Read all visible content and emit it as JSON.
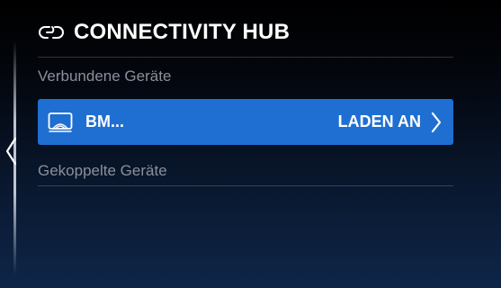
{
  "header": {
    "title": "CONNECTIVITY HUB",
    "icon": "link-chain-icon"
  },
  "sections": {
    "connected_label": "Verbundene Geräte",
    "paired_label": "Gekoppelte Geräte"
  },
  "connected_devices": [
    {
      "name": "BM...",
      "action": "LADEN AN",
      "icon": "phone-charging-icon"
    }
  ],
  "navigation": {
    "back_icon": "chevron-left-icon"
  },
  "colors": {
    "highlight": "#1f6fd2",
    "section_label": "#8a909b",
    "text": "#ffffff"
  }
}
